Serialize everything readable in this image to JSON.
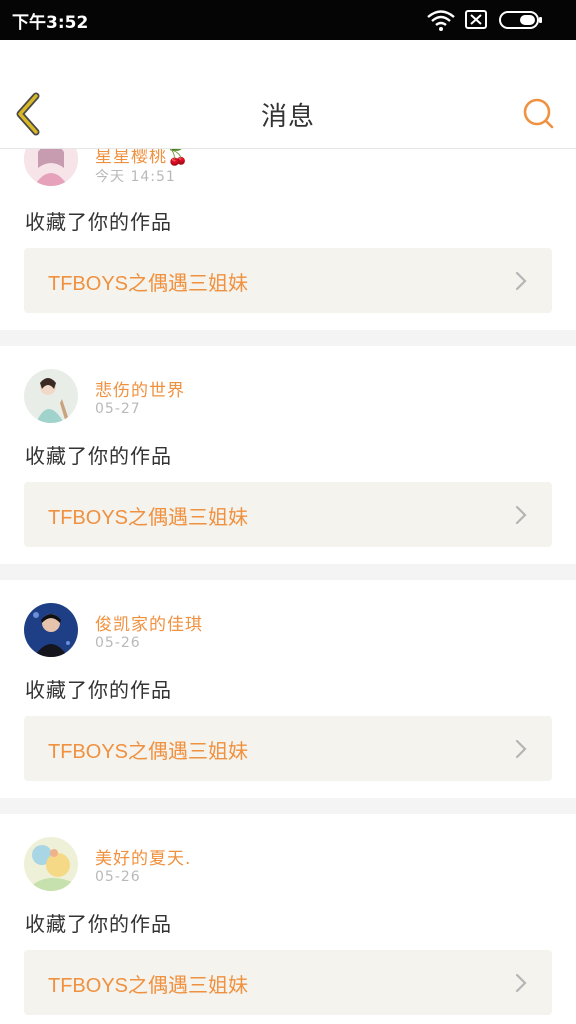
{
  "status_bar": {
    "time": "下午3:52",
    "icons": [
      "wifi-icon",
      "sim-disabled-icon",
      "battery-icon"
    ]
  },
  "header": {
    "title": "消息",
    "back_icon": "chevron-left-icon",
    "search_icon": "search-icon"
  },
  "colors": {
    "accent": "#f0913f",
    "back_icon": "#d9b826",
    "card_link_bg": "#f4f3ee",
    "separator": "#f4f4f4"
  },
  "messages": [
    {
      "user": "星星樱桃🍒",
      "time": "今天 14:51",
      "action": "收藏了你的作品",
      "work": "TFBOYS之偶遇三姐妹"
    },
    {
      "user": "悲伤的世界",
      "time": "05-27",
      "action": "收藏了你的作品",
      "work": "TFBOYS之偶遇三姐妹"
    },
    {
      "user": "俊凯家的佳琪",
      "time": "05-26",
      "action": "收藏了你的作品",
      "work": "TFBOYS之偶遇三姐妹"
    },
    {
      "user": "美好的夏天.",
      "time": "05-26",
      "action": "收藏了你的作品",
      "work": "TFBOYS之偶遇三姐妹"
    }
  ]
}
